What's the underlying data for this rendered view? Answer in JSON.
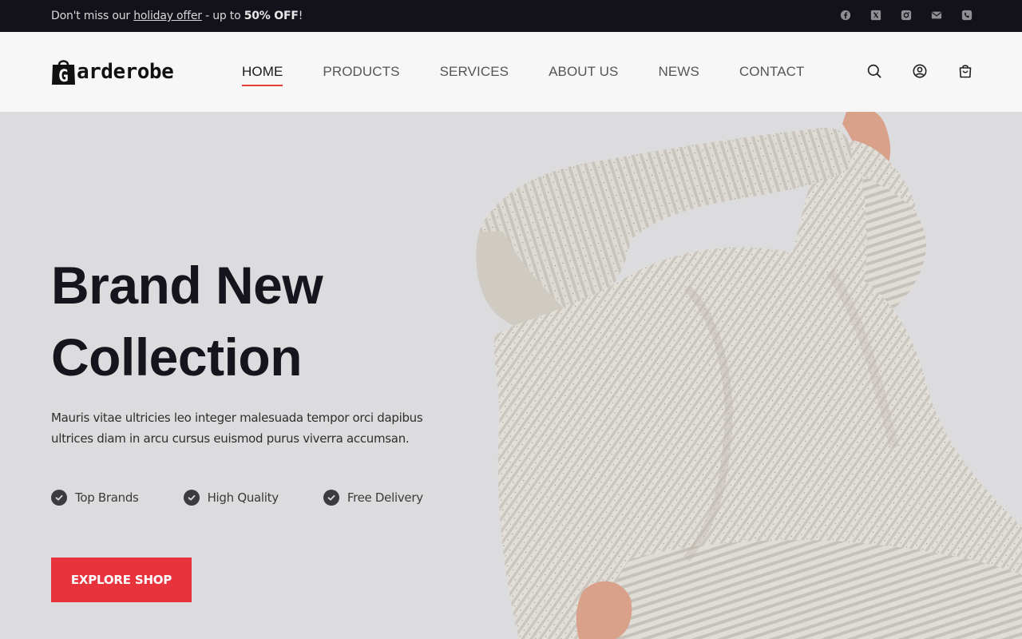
{
  "topbar": {
    "msg_prefix": "Don't miss our ",
    "msg_link": "holiday offer",
    "msg_middle": " - up to ",
    "msg_bold": "50% OFF",
    "msg_suffix": "!",
    "social_icons": [
      "facebook-icon",
      "x-twitter-icon",
      "instagram-icon",
      "mail-icon",
      "phone-icon"
    ]
  },
  "header": {
    "logo_letter": "G",
    "logo_rest": "arderobe",
    "nav": [
      {
        "label": "HOME",
        "active": true
      },
      {
        "label": "PRODUCTS"
      },
      {
        "label": "SERVICES"
      },
      {
        "label": "ABOUT US"
      },
      {
        "label": "NEWS"
      },
      {
        "label": "CONTACT"
      }
    ],
    "icons": [
      "search-icon",
      "account-icon",
      "cart-icon"
    ]
  },
  "hero": {
    "title_line1": "Brand New",
    "title_line2": "Collection",
    "description": "Mauris vitae ultricies leo integer malesuada tempor orci dapibus ultrices diam in arcu cursus euismod purus viverra accumsan.",
    "features": [
      "Top Brands",
      "High Quality",
      "Free Delivery"
    ],
    "cta_label": "EXPLORE SHOP"
  },
  "colors": {
    "accent": "#e8323c",
    "topbar_bg": "#13111a",
    "hero_bg": "#dcdcde",
    "text_dark": "#16141c"
  }
}
